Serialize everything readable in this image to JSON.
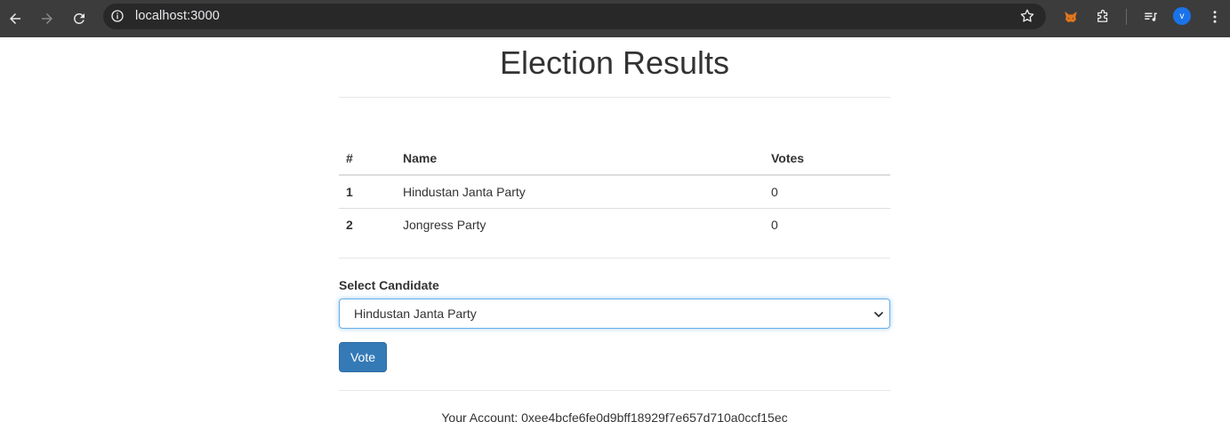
{
  "browser": {
    "url": "localhost:3000",
    "profile_initial": "v"
  },
  "page": {
    "title": "Election Results"
  },
  "table": {
    "headers": [
      "#",
      "Name",
      "Votes"
    ],
    "rows": [
      {
        "id": "1",
        "name": "Hindustan Janta Party",
        "votes": "0"
      },
      {
        "id": "2",
        "name": "Jongress Party",
        "votes": "0"
      }
    ]
  },
  "form": {
    "label": "Select Candidate",
    "selected_option": "Hindustan Janta Party",
    "vote_button": "Vote"
  },
  "account": {
    "text": "Your Account: 0xee4bcfe6fe0d9bff18929f7e657d710a0ccf15ec"
  }
}
